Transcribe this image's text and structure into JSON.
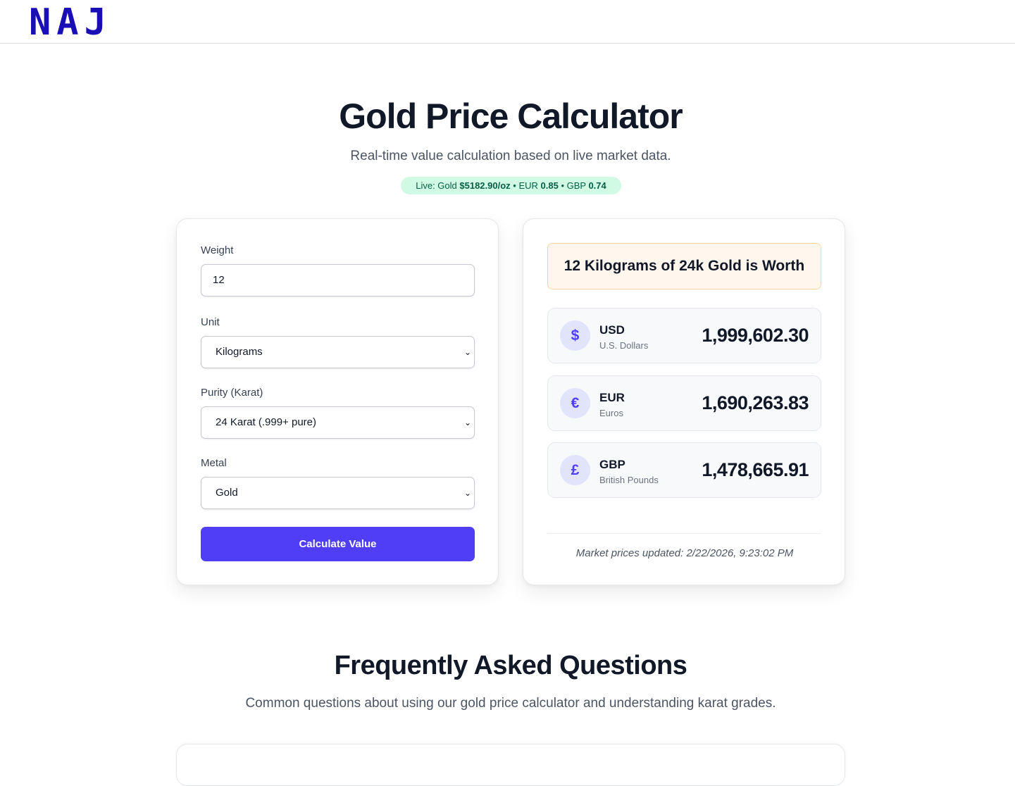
{
  "brand": {
    "logo": "NAJ"
  },
  "hero": {
    "title": "Gold Price Calculator",
    "subtitle": "Real-time value calculation based on live market data.",
    "live": {
      "prefix": "Live: Gold ",
      "gold": "$5182.90/oz",
      "eur_label": " • EUR ",
      "eur": "0.85",
      "gbp_label": " • GBP ",
      "gbp": "0.74"
    }
  },
  "form": {
    "weight_label": "Weight",
    "weight_value": "12",
    "unit_label": "Unit",
    "unit_value": "Kilograms",
    "purity_label": "Purity (Karat)",
    "purity_value": "24 Karat (.999+ pure)",
    "metal_label": "Metal",
    "metal_value": "Gold",
    "calculate_label": "Calculate Value"
  },
  "result": {
    "heading": "12 Kilograms of 24k Gold is Worth",
    "currencies": [
      {
        "symbol": "$",
        "code": "USD",
        "name": "U.S. Dollars",
        "value": "1,999,602.30",
        "icon": "dollar-icon"
      },
      {
        "symbol": "€",
        "code": "EUR",
        "name": "Euros",
        "value": "1,690,263.83",
        "icon": "euro-icon"
      },
      {
        "symbol": "£",
        "code": "GBP",
        "name": "British Pounds",
        "value": "1,478,665.91",
        "icon": "pound-icon"
      }
    ],
    "updated": "Market prices updated: 2/22/2026, 9:23:02 PM"
  },
  "faq": {
    "title": "Frequently Asked Questions",
    "subtitle": "Common questions about using our gold price calculator and understanding karat grades."
  },
  "colors": {
    "brand": "#1a0fb5",
    "accent": "#4f3ef6",
    "live_bg": "#d1fae5",
    "live_text": "#065f46",
    "result_bg": "#fff7ed"
  }
}
